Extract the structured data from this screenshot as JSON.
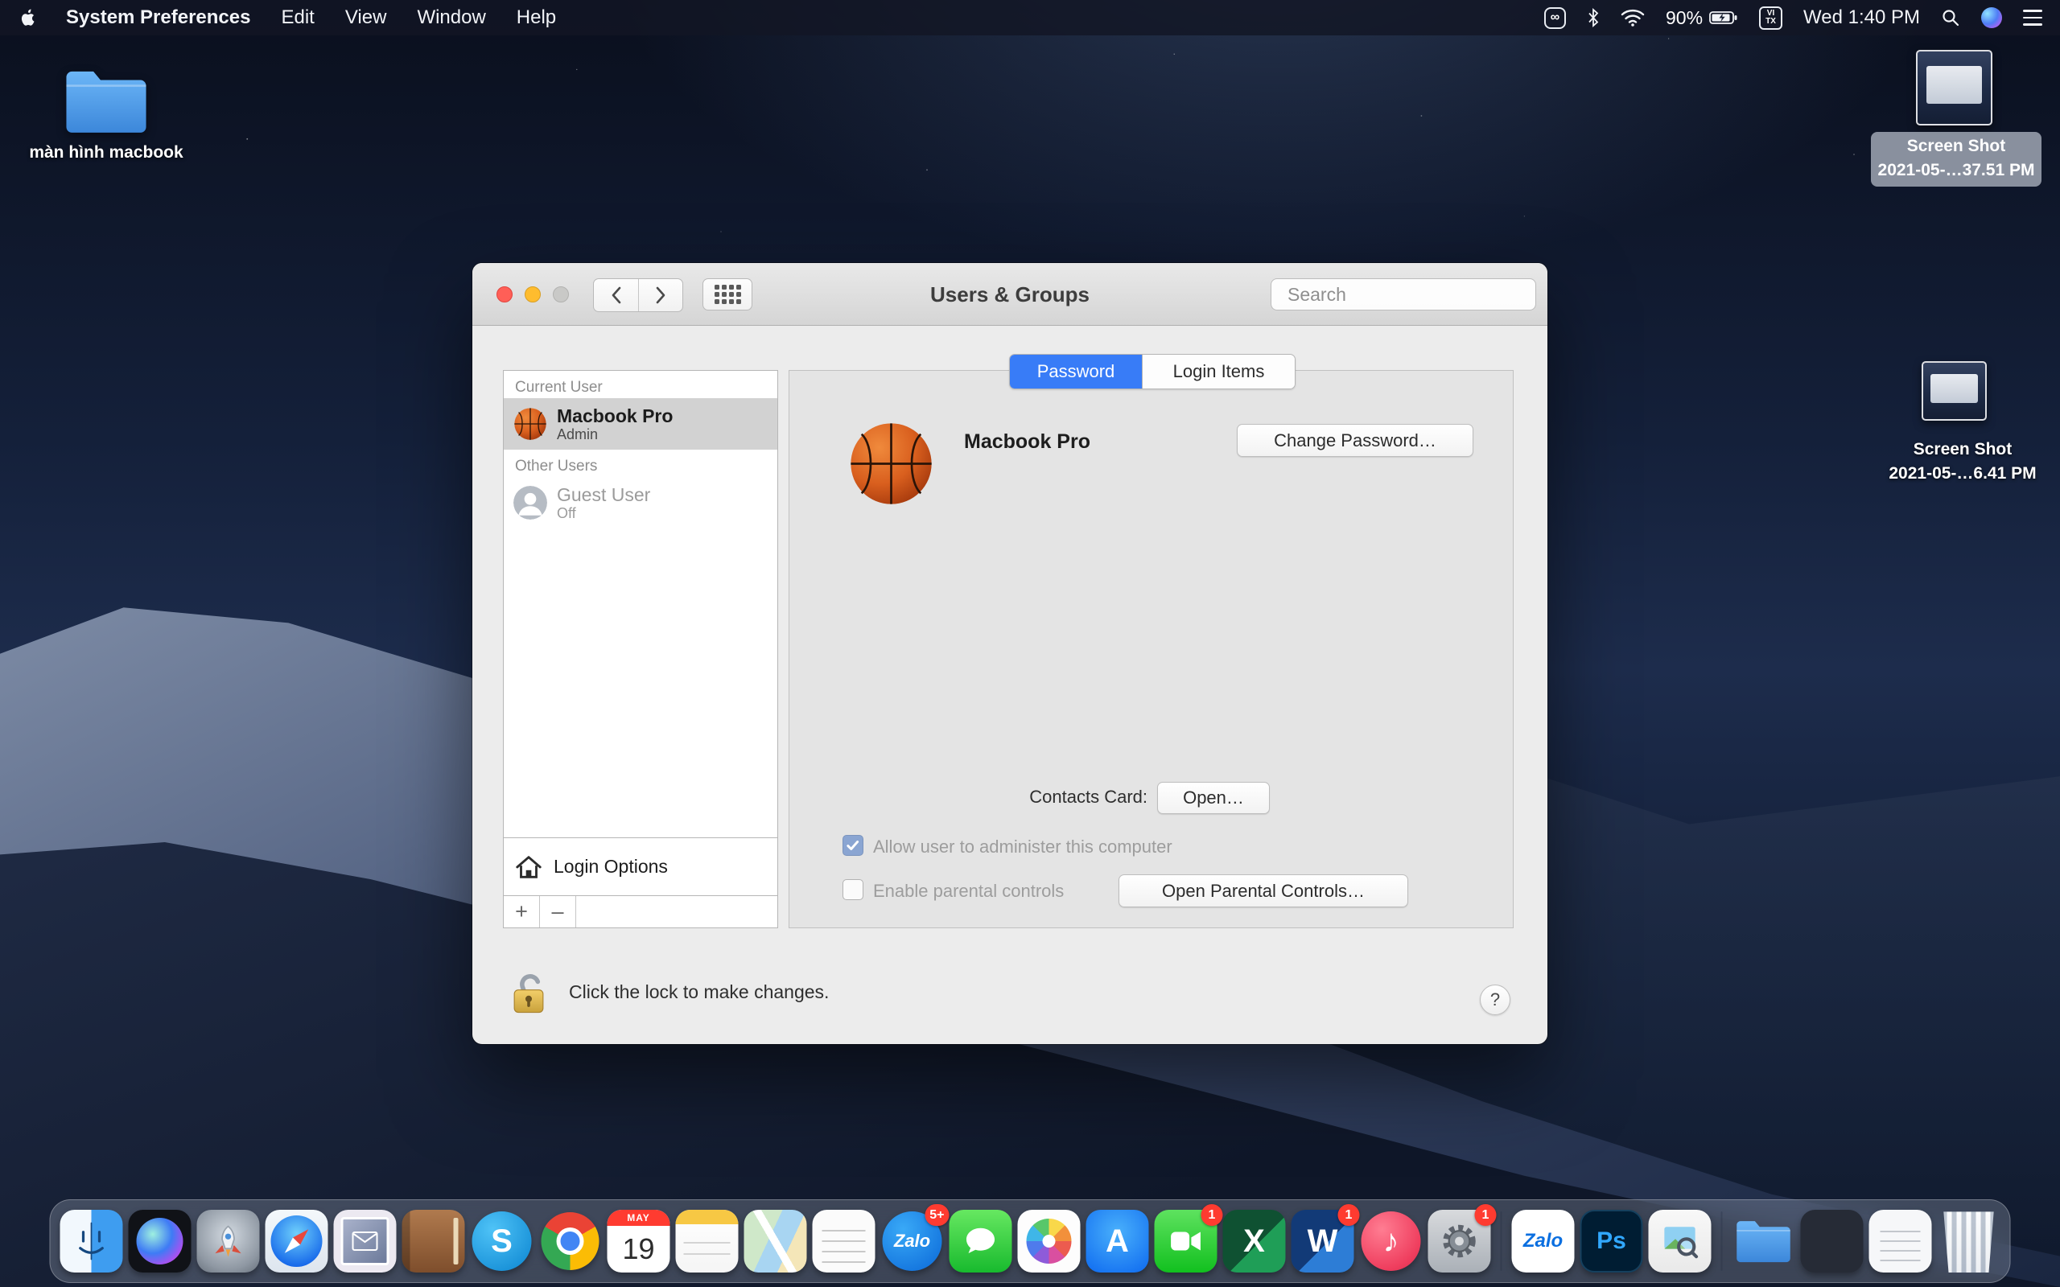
{
  "colors": {
    "accent_blue": "#387cf7",
    "badge_red": "#ff3b30",
    "folder_blue": "#4f9ef0"
  },
  "menu_bar": {
    "app_name": "System Preferences",
    "menus": [
      "Edit",
      "View",
      "Window",
      "Help"
    ],
    "status": {
      "battery_percent": "90%",
      "input_line1": "VI",
      "input_line2": "TX",
      "clock": "Wed 1:40 PM"
    }
  },
  "desktop": {
    "folder_label": "màn hình macbook",
    "screenshots": [
      {
        "line1": "Screen Shot",
        "line2": "2021-05-…37.51 PM"
      },
      {
        "line1": "Screen Shot",
        "line2": "2021-05-…6.41 PM"
      }
    ]
  },
  "window": {
    "title": "Users & Groups",
    "search_placeholder": "Search",
    "tabs": {
      "password": "Password",
      "login_items": "Login Items",
      "active": "Password"
    },
    "sidebar": {
      "current_user_header": "Current User",
      "user_name": "Macbook Pro",
      "user_role": "Admin",
      "other_users_header": "Other Users",
      "guest_name": "Guest User",
      "guest_status": "Off",
      "login_options": "Login Options",
      "add_label": "+",
      "remove_label": "–"
    },
    "pane": {
      "user_name": "Macbook Pro",
      "change_password_button": "Change Password…",
      "contacts_card_label": "Contacts Card:",
      "open_button": "Open…",
      "admin_checkbox_label": "Allow user to administer this computer",
      "admin_checkbox_checked": true,
      "parental_checkbox_label": "Enable parental controls",
      "parental_checkbox_checked": false,
      "parental_button": "Open Parental Controls…"
    },
    "footer": {
      "lock_text": "Click the lock to make changes.",
      "help_label": "?"
    }
  },
  "dock": {
    "items": [
      {
        "name": "finder"
      },
      {
        "name": "siri"
      },
      {
        "name": "launchpad"
      },
      {
        "name": "safari"
      },
      {
        "name": "mail"
      },
      {
        "name": "contacts"
      },
      {
        "name": "skype",
        "glyph": "S"
      },
      {
        "name": "chrome"
      },
      {
        "name": "calendar",
        "month": "MAY",
        "day": "19"
      },
      {
        "name": "notes"
      },
      {
        "name": "maps"
      },
      {
        "name": "textedit"
      },
      {
        "name": "zalo",
        "glyph": "Zalo",
        "badge": "5+"
      },
      {
        "name": "messages"
      },
      {
        "name": "photos"
      },
      {
        "name": "app-store",
        "glyph": "A"
      },
      {
        "name": "facetime",
        "badge": "1"
      },
      {
        "name": "excel",
        "glyph": "X"
      },
      {
        "name": "word",
        "glyph": "W",
        "badge": "1"
      },
      {
        "name": "music",
        "glyph": "♪"
      },
      {
        "name": "system-preferences",
        "badge": "1"
      },
      {
        "name": "zalo-app",
        "glyph": "Zalo"
      },
      {
        "name": "photoshop",
        "glyph": "Ps"
      },
      {
        "name": "preview"
      },
      {
        "name": "downloads"
      },
      {
        "name": "apps-folder"
      },
      {
        "name": "documents-folder"
      },
      {
        "name": "trash"
      }
    ]
  }
}
